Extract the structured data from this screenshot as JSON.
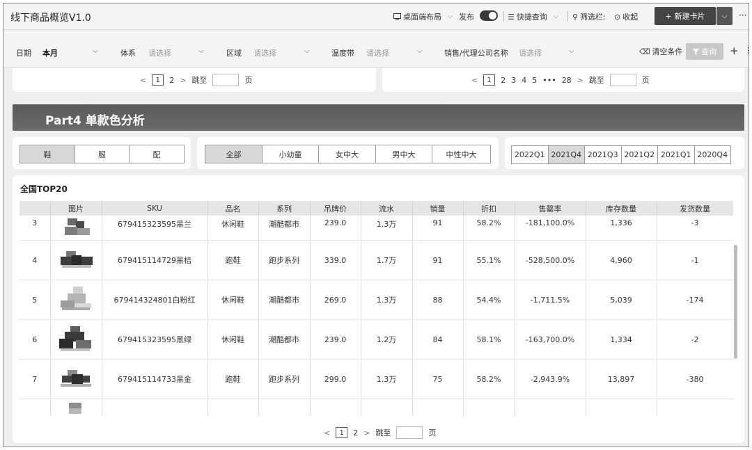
{
  "app": {
    "title": "线下商品概览V1.0"
  },
  "toolbar": {
    "desktop_layout": "桌面端布局",
    "publish": "发布",
    "quick_query": "快捷查询",
    "filter_bar": "筛选栏:",
    "collapse": "收起",
    "new_card": "新建卡片",
    "more": "···"
  },
  "filters": {
    "date_label": "日期",
    "date_value": "本月",
    "system_label": "体系",
    "system_ph": "请选择",
    "region_label": "区域",
    "region_ph": "请选择",
    "temp_label": "温度带",
    "temp_ph": "请选择",
    "company_label": "销售/代理公司名称",
    "company_ph": "请选择",
    "clear": "清空条件",
    "query": "查询",
    "add": "+",
    "more": "⋮"
  },
  "pagers": {
    "left": {
      "current": "1",
      "pages": [
        "2"
      ],
      "goto": "跳至",
      "unit": "页"
    },
    "right": {
      "current": "1",
      "pages": [
        "2",
        "3",
        "4",
        "5",
        "•••",
        "28"
      ],
      "goto": "跳至",
      "unit": "页"
    },
    "bottom": {
      "current": "1",
      "pages": [
        "2"
      ],
      "goto": "跳至",
      "unit": "页"
    }
  },
  "part": {
    "title": "Part4 单款色分析"
  },
  "category_tabs": [
    {
      "label": "鞋",
      "active": true
    },
    {
      "label": "服",
      "active": false
    },
    {
      "label": "配",
      "active": false
    }
  ],
  "group_tabs": [
    {
      "label": "全部",
      "active": true
    },
    {
      "label": "小幼童",
      "active": false
    },
    {
      "label": "女中大",
      "active": false
    },
    {
      "label": "男中大",
      "active": false
    },
    {
      "label": "中性中大",
      "active": false
    }
  ],
  "quarter_tabs": [
    {
      "label": "2022Q1",
      "active": false
    },
    {
      "label": "2021Q4",
      "active": true
    },
    {
      "label": "2021Q3",
      "active": false
    },
    {
      "label": "2021Q2",
      "active": false
    },
    {
      "label": "2021Q1",
      "active": false
    },
    {
      "label": "2020Q4",
      "active": false
    }
  ],
  "table": {
    "title": "全国TOP20",
    "columns": [
      "",
      "图片",
      "SKU",
      "品名",
      "系列",
      "吊牌价",
      "流水",
      "销量",
      "折扣",
      "售罄率",
      "库存数量",
      "发货数量"
    ],
    "rows": [
      {
        "rank": "3",
        "sku": "679415323595黑兰",
        "name": "休闲鞋",
        "series": "潮酷都市",
        "price": "239.0",
        "flow": "1.3万",
        "sales": "91",
        "discount": "58.2%",
        "sellthrough": "-181,100.0%",
        "stock": "1,336",
        "shipped": "-3"
      },
      {
        "rank": "4",
        "sku": "679415114729黑桔",
        "name": "跑鞋",
        "series": "跑步系列",
        "price": "339.0",
        "flow": "1.7万",
        "sales": "91",
        "discount": "55.1%",
        "sellthrough": "-528,500.0%",
        "stock": "4,960",
        "shipped": "-1"
      },
      {
        "rank": "5",
        "sku": "679414324801白粉红",
        "name": "休闲鞋",
        "series": "潮酷都市",
        "price": "269.0",
        "flow": "1.3万",
        "sales": "88",
        "discount": "54.4%",
        "sellthrough": "-1,711.5%",
        "stock": "5,039",
        "shipped": "-174"
      },
      {
        "rank": "6",
        "sku": "679415323595黑绿",
        "name": "休闲鞋",
        "series": "潮酷都市",
        "price": "239.0",
        "flow": "1.2万",
        "sales": "84",
        "discount": "58.1%",
        "sellthrough": "-163,700.0%",
        "stock": "1,334",
        "shipped": "-2"
      },
      {
        "rank": "7",
        "sku": "679415114733黑金",
        "name": "跑鞋",
        "series": "跑步系列",
        "price": "299.0",
        "flow": "1.3万",
        "sales": "75",
        "discount": "58.2%",
        "sellthrough": "-2,943.9%",
        "stock": "13,897",
        "shipped": "-380"
      }
    ]
  }
}
